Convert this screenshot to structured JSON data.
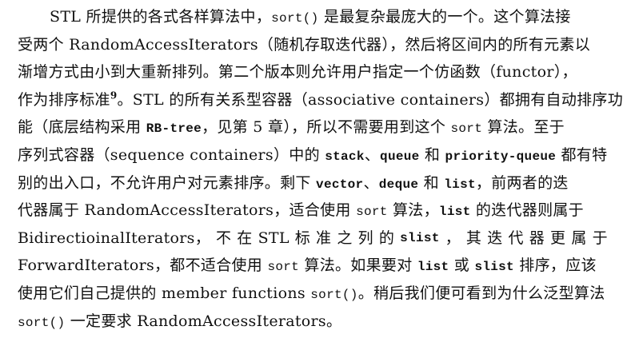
{
  "lines": [
    [
      {
        "t": "STL 所提供的各式各样算法中，"
      },
      {
        "t": "sort()",
        "s": "mono"
      },
      {
        "t": " 是最复杂最庞大的一个。这个算法接"
      }
    ],
    [
      {
        "t": "受两个 RandomAccessIterators（随机存取迭代器），然后将区间内的所有元素以"
      }
    ],
    [
      {
        "t": "渐增方式由小到大重新排列。第二个版本则允许用户指定一个仿函数（functor），"
      }
    ],
    [
      {
        "t": "作为排序标准"
      },
      {
        "t": "9",
        "s": "sup"
      },
      {
        "t": "。STL 的所有关系型容器（associative containers）都拥有自动排序功"
      }
    ],
    [
      {
        "t": "能（底层结构采用 "
      },
      {
        "t": "RB-tree",
        "s": "mono bold"
      },
      {
        "t": "，见第 5 章），所以不需要用到这个 "
      },
      {
        "t": "sort",
        "s": "mono"
      },
      {
        "t": " 算法。至于"
      }
    ],
    [
      {
        "t": "序列式容器（sequence containers）中的 "
      },
      {
        "t": "stack",
        "s": "mono bold"
      },
      {
        "t": "、"
      },
      {
        "t": "queue",
        "s": "mono bold"
      },
      {
        "t": " 和 "
      },
      {
        "t": "priority-queue",
        "s": "mono bold"
      },
      {
        "t": " 都有特"
      }
    ],
    [
      {
        "t": "别的出入口，不允许用户对元素排序。剩下 "
      },
      {
        "t": "vector",
        "s": "mono bold"
      },
      {
        "t": "、"
      },
      {
        "t": "deque",
        "s": "mono bold"
      },
      {
        "t": " 和 "
      },
      {
        "t": "list",
        "s": "mono bold"
      },
      {
        "t": "，前两者的迭"
      }
    ],
    [
      {
        "t": "代器属于 RandomAccessIterators，适合使用 "
      },
      {
        "t": "sort",
        "s": "mono"
      },
      {
        "t": " 算法，"
      },
      {
        "t": "list",
        "s": "mono bold"
      },
      {
        "t": " 的迭代器则属于"
      }
    ],
    [
      {
        "t": "BidirectioinalIterators，"
      },
      {
        "t": "不"
      },
      {
        "t": "在"
      },
      {
        "t": "STL"
      },
      {
        "t": "标"
      },
      {
        "t": "准"
      },
      {
        "t": "之"
      },
      {
        "t": "列"
      },
      {
        "t": "的"
      },
      {
        "t": "slist",
        "s": "mono bold"
      },
      {
        "t": "，"
      },
      {
        "t": "其"
      },
      {
        "t": "迭"
      },
      {
        "t": "代"
      },
      {
        "t": "器"
      },
      {
        "t": "更"
      },
      {
        "t": "属"
      },
      {
        "t": "于"
      }
    ],
    [
      {
        "t": "ForwardIterators，都不适合使用 "
      },
      {
        "t": "sort",
        "s": "mono"
      },
      {
        "t": " 算法。如果要对 "
      },
      {
        "t": "list",
        "s": "mono bold"
      },
      {
        "t": " 或 "
      },
      {
        "t": "slist",
        "s": "mono bold"
      },
      {
        "t": " 排序，应该"
      }
    ],
    [
      {
        "t": "使用它们自己提供的 member functions "
      },
      {
        "t": "sort()",
        "s": "mono"
      },
      {
        "t": "。稍后我们便可看到为什么泛型算法"
      }
    ],
    [
      {
        "t": "sort()",
        "s": "mono"
      },
      {
        "t": " 一定要求 RandomAccessIterators。"
      }
    ]
  ]
}
